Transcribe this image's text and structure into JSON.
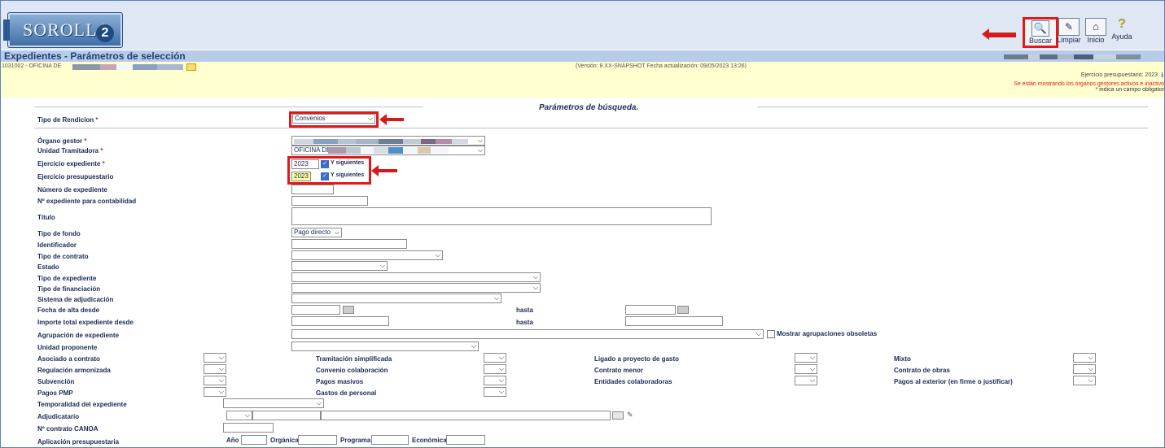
{
  "app": {
    "logo_text": "SOROLLA",
    "logo_num": "2"
  },
  "toolbar": {
    "buscar": "Buscar",
    "limpiar": "Limpiar",
    "inicio": "Inicio",
    "ayuda": "Ayuda"
  },
  "page_title": "Expedientes - Parámetros de selección",
  "org_text": "1031002 - OFICINA DE",
  "version_text": "(Versión: 8.XX-SNAPSHOT Fecha actualización: 09/05/2023 13:26)",
  "ejercicio_text": "Ejercicio presupuestario: 2023",
  "warning_text": "Se están mostrando los órganos gestores activos e inactivo",
  "required_note": "* indica un campo obligator",
  "section_title": "Parámetros de búsqueda.",
  "fields": {
    "tipo_rendicion": {
      "label": "Tipo de Rendicion",
      "value": "Convenios"
    },
    "organo_gestor": {
      "label": "Órgano gestor"
    },
    "unidad_tramitadora": {
      "label": "Unidad Tramitadora",
      "value": "OFICINA DE"
    },
    "ejercicio_expediente": {
      "label": "Ejercicio expediente",
      "value": "2023",
      "check_label": "Y siguientes"
    },
    "ejercicio_presupuestario": {
      "label": "Ejercicio presupuestario",
      "value": "2023",
      "check_label": "Y siguientes"
    },
    "numero_expediente": {
      "label": "Número de expediente"
    },
    "expediente_contabilidad": {
      "label": "Nº expediente para contabilidad"
    },
    "titulo": {
      "label": "Título"
    },
    "tipo_fondo": {
      "label": "Tipo de fondo",
      "value": "Pago directo"
    },
    "identificador": {
      "label": "Identificador"
    },
    "tipo_contrato": {
      "label": "Tipo de contrato"
    },
    "estado": {
      "label": "Estado"
    },
    "tipo_expediente": {
      "label": "Tipo de expediente"
    },
    "tipo_financiacion": {
      "label": "Tipo de financiación"
    },
    "sistema_adjudicacion": {
      "label": "Sistema de adjudicación"
    },
    "fecha_alta": {
      "label": "Fecha de alta desde",
      "hasta": "hasta"
    },
    "importe_total": {
      "label": "Importe total expediente desde",
      "hasta": "hasta"
    },
    "agrupacion": {
      "label": "Agrupación de expediente",
      "check_label": "Mostrar agrupaciones obsoletas"
    },
    "unidad_proponente": {
      "label": "Unidad proponente"
    },
    "temporalidad": {
      "label": "Temporalidad del expediente"
    },
    "adjudicatario": {
      "label": "Adjudicatario"
    },
    "contrato_canoa": {
      "label": "Nº contrato CANOA"
    },
    "aplicacion": {
      "label": "Aplicación presupuestaria",
      "anio": "Año",
      "organica": "Orgánica",
      "programa": "Programa",
      "economica": "Económica"
    }
  },
  "grid": {
    "col1": [
      "Asociado a contrato",
      "Regulación armonizada",
      "Subvención",
      "Pagos PMP"
    ],
    "col2": [
      "Tramitación simplificada",
      "Convenio colaboración",
      "Pagos masivos",
      "Gastos de personal"
    ],
    "col3": [
      "Ligado a proyecto de gasto",
      "Contrato menor",
      "Entidades colaboradoras"
    ],
    "col4": [
      "Mixto",
      "Contrato de obras",
      "Pagos al exterior (en firme o justificar)"
    ]
  },
  "colors": {
    "accent_red": "#e01a1a",
    "title_blue": "#1e3f7a",
    "info_yellow": "#ffffcf"
  }
}
